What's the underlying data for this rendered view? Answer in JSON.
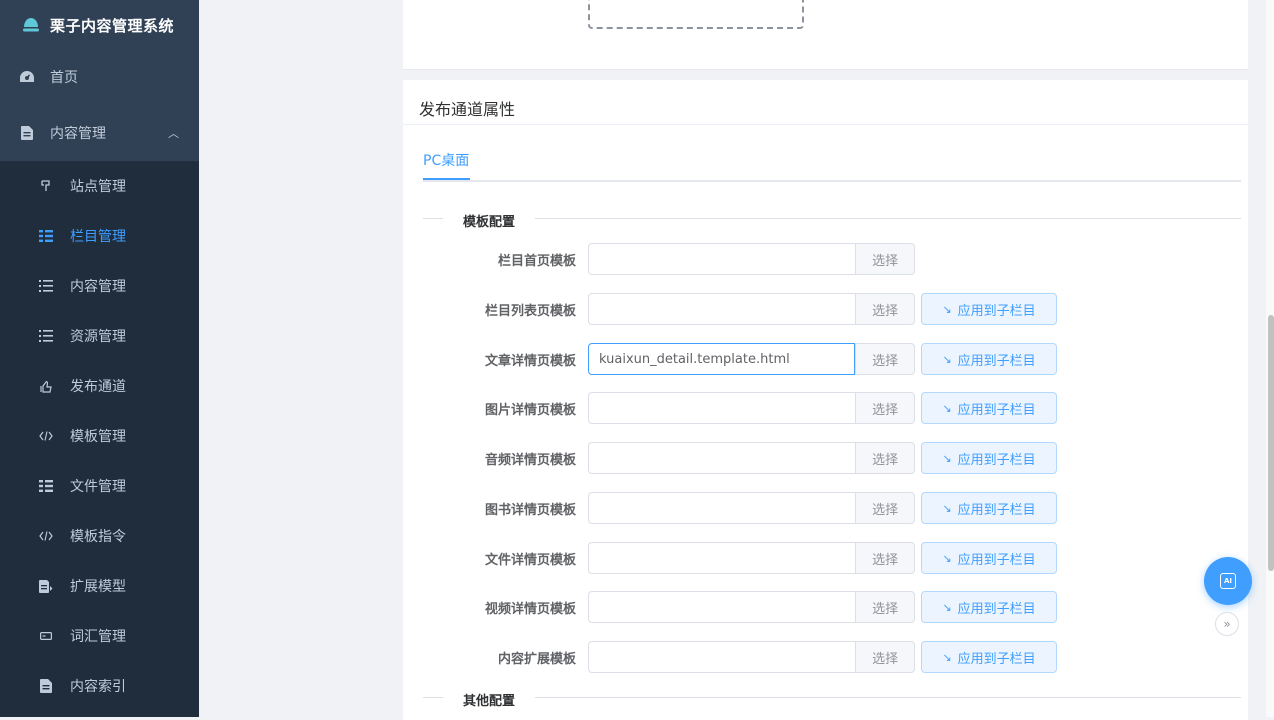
{
  "app": {
    "title": "栗子内容管理系统"
  },
  "sidebar": {
    "items": [
      {
        "label": "首页",
        "icon": "dashboard-icon"
      },
      {
        "label": "内容管理",
        "icon": "document-icon",
        "expanded": true
      }
    ],
    "submenu": [
      {
        "label": "站点管理",
        "icon": "site-icon"
      },
      {
        "label": "栏目管理",
        "icon": "tree-icon",
        "active": true
      },
      {
        "label": "内容管理",
        "icon": "list-icon"
      },
      {
        "label": "资源管理",
        "icon": "list-icon"
      },
      {
        "label": "发布通道",
        "icon": "publish-icon"
      },
      {
        "label": "模板管理",
        "icon": "code-icon"
      },
      {
        "label": "文件管理",
        "icon": "tree-icon"
      },
      {
        "label": "模板指令",
        "icon": "code-icon"
      },
      {
        "label": "扩展模型",
        "icon": "edit-document-icon"
      },
      {
        "label": "词汇管理",
        "icon": "tag-icon"
      },
      {
        "label": "内容索引",
        "icon": "document-icon"
      }
    ]
  },
  "card": {
    "title": "发布通道属性",
    "tabs": [
      {
        "label": "PC桌面",
        "active": true
      }
    ],
    "template_section": {
      "title": "模板配置"
    },
    "other_section": {
      "title": "其他配置"
    },
    "choose_label": "选择",
    "apply_label": "应用到子栏目",
    "fields": [
      {
        "label": "栏目首页模板",
        "value": "",
        "has_apply": false
      },
      {
        "label": "栏目列表页模板",
        "value": "",
        "has_apply": true
      },
      {
        "label": "文章详情页模板",
        "value": "kuaixun_detail.template.html",
        "has_apply": true,
        "focused": true
      },
      {
        "label": "图片详情页模板",
        "value": "",
        "has_apply": true
      },
      {
        "label": "音频详情页模板",
        "value": "",
        "has_apply": true
      },
      {
        "label": "图书详情页模板",
        "value": "",
        "has_apply": true
      },
      {
        "label": "文件详情页模板",
        "value": "",
        "has_apply": true
      },
      {
        "label": "视频详情页模板",
        "value": "",
        "has_apply": true
      },
      {
        "label": "内容扩展模板",
        "value": "",
        "has_apply": true
      }
    ]
  },
  "floating": {
    "ai_label": "AI"
  },
  "colors": {
    "sidebar_bg": "#304156",
    "submenu_bg": "#1f2d3d",
    "accent": "#409eff"
  }
}
